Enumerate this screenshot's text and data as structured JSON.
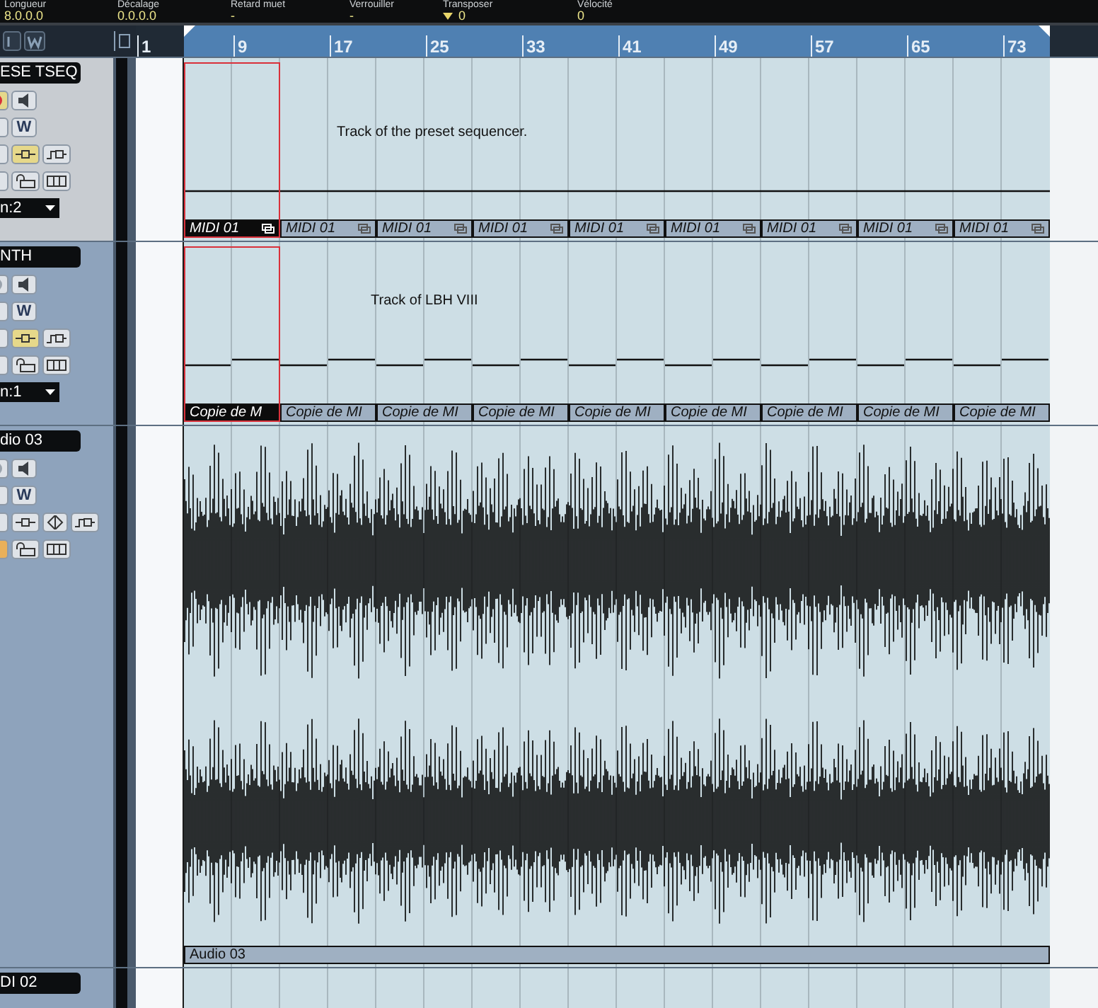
{
  "info_bar": [
    {
      "label": "Longueur",
      "value": "8.0.0.0",
      "kind": "text"
    },
    {
      "label": "Décalage",
      "value": "0.0.0.0",
      "kind": "text"
    },
    {
      "label": "Retard muet",
      "value": "-",
      "kind": "text"
    },
    {
      "label": "Verrouiller",
      "value": "-",
      "kind": "text"
    },
    {
      "label": "Transposer",
      "value": "0",
      "kind": "dropdown"
    },
    {
      "label": "Vélocité",
      "value": "0",
      "kind": "text"
    }
  ],
  "ruler": {
    "start": "1",
    "marks": [
      "9",
      "17",
      "25",
      "33",
      "41",
      "49",
      "57",
      "65",
      "73"
    ]
  },
  "tracks": [
    {
      "kind": "sequence",
      "name": "ESE TSEQ",
      "selected": true,
      "channel": "n:2",
      "note": "Track of the preset sequencer.",
      "button_rows": [
        [
          {
            "kind": "record",
            "on": true
          },
          {
            "kind": "speaker",
            "on": false
          }
        ],
        [
          {
            "kind": "plain",
            "on": false
          },
          {
            "kind": "write",
            "label": "W",
            "on": false
          }
        ],
        [
          {
            "kind": "plain",
            "on": false
          },
          {
            "kind": "insert",
            "on": true
          },
          {
            "kind": "send",
            "on": false
          }
        ],
        [
          {
            "kind": "plain",
            "on": false
          },
          {
            "kind": "lock",
            "on": false
          },
          {
            "kind": "editor",
            "on": false
          }
        ]
      ],
      "parts": [
        {
          "label": "MIDI 01",
          "selected": true
        },
        {
          "label": "MIDI 01",
          "selected": false
        },
        {
          "label": "MIDI 01",
          "selected": false
        },
        {
          "label": "MIDI 01",
          "selected": false
        },
        {
          "label": "MIDI 01",
          "selected": false
        },
        {
          "label": "MIDI 01",
          "selected": false
        },
        {
          "label": "MIDI 01",
          "selected": false
        },
        {
          "label": "MIDI 01",
          "selected": false
        },
        {
          "label": "MIDI 01",
          "selected": false
        }
      ]
    },
    {
      "kind": "steps",
      "name": "NTH",
      "selected": false,
      "channel": "n:1",
      "note": "Track of LBH VIII",
      "button_rows": [
        [
          {
            "kind": "record",
            "on": false
          },
          {
            "kind": "speaker",
            "on": false
          }
        ],
        [
          {
            "kind": "plain",
            "on": false
          },
          {
            "kind": "write",
            "label": "W",
            "on": false
          }
        ],
        [
          {
            "kind": "plain",
            "on": false
          },
          {
            "kind": "insert",
            "on": true
          },
          {
            "kind": "send",
            "on": false
          }
        ],
        [
          {
            "kind": "plain",
            "on": false
          },
          {
            "kind": "lock",
            "on": false
          },
          {
            "kind": "editor",
            "on": false
          }
        ]
      ],
      "parts": [
        {
          "label": "Copie de M",
          "selected": true
        },
        {
          "label": "Copie de MI",
          "selected": false
        },
        {
          "label": "Copie de MI",
          "selected": false
        },
        {
          "label": "Copie de MI",
          "selected": false
        },
        {
          "label": "Copie de MI",
          "selected": false
        },
        {
          "label": "Copie de MI",
          "selected": false
        },
        {
          "label": "Copie de MI",
          "selected": false
        },
        {
          "label": "Copie de MI",
          "selected": false
        },
        {
          "label": "Copie de MI",
          "selected": false
        }
      ]
    },
    {
      "kind": "audio",
      "name": "dio 03",
      "selected": false,
      "button_rows": [
        [
          {
            "kind": "record",
            "on": false
          },
          {
            "kind": "speaker",
            "on": false
          }
        ],
        [
          {
            "kind": "plain",
            "on": false
          },
          {
            "kind": "write",
            "label": "W",
            "on": false
          }
        ],
        [
          {
            "kind": "plain",
            "on": false
          },
          {
            "kind": "insert",
            "on": false
          },
          {
            "kind": "pan",
            "on": false
          },
          {
            "kind": "send",
            "on": false
          }
        ],
        [
          {
            "kind": "plain",
            "on": true
          },
          {
            "kind": "lock",
            "on": false
          },
          {
            "kind": "editor",
            "on": false
          }
        ]
      ],
      "parts": [
        {
          "label": "Audio 03",
          "selected": false
        }
      ]
    },
    {
      "kind": "stub",
      "name": "DI 02",
      "selected": false
    }
  ]
}
